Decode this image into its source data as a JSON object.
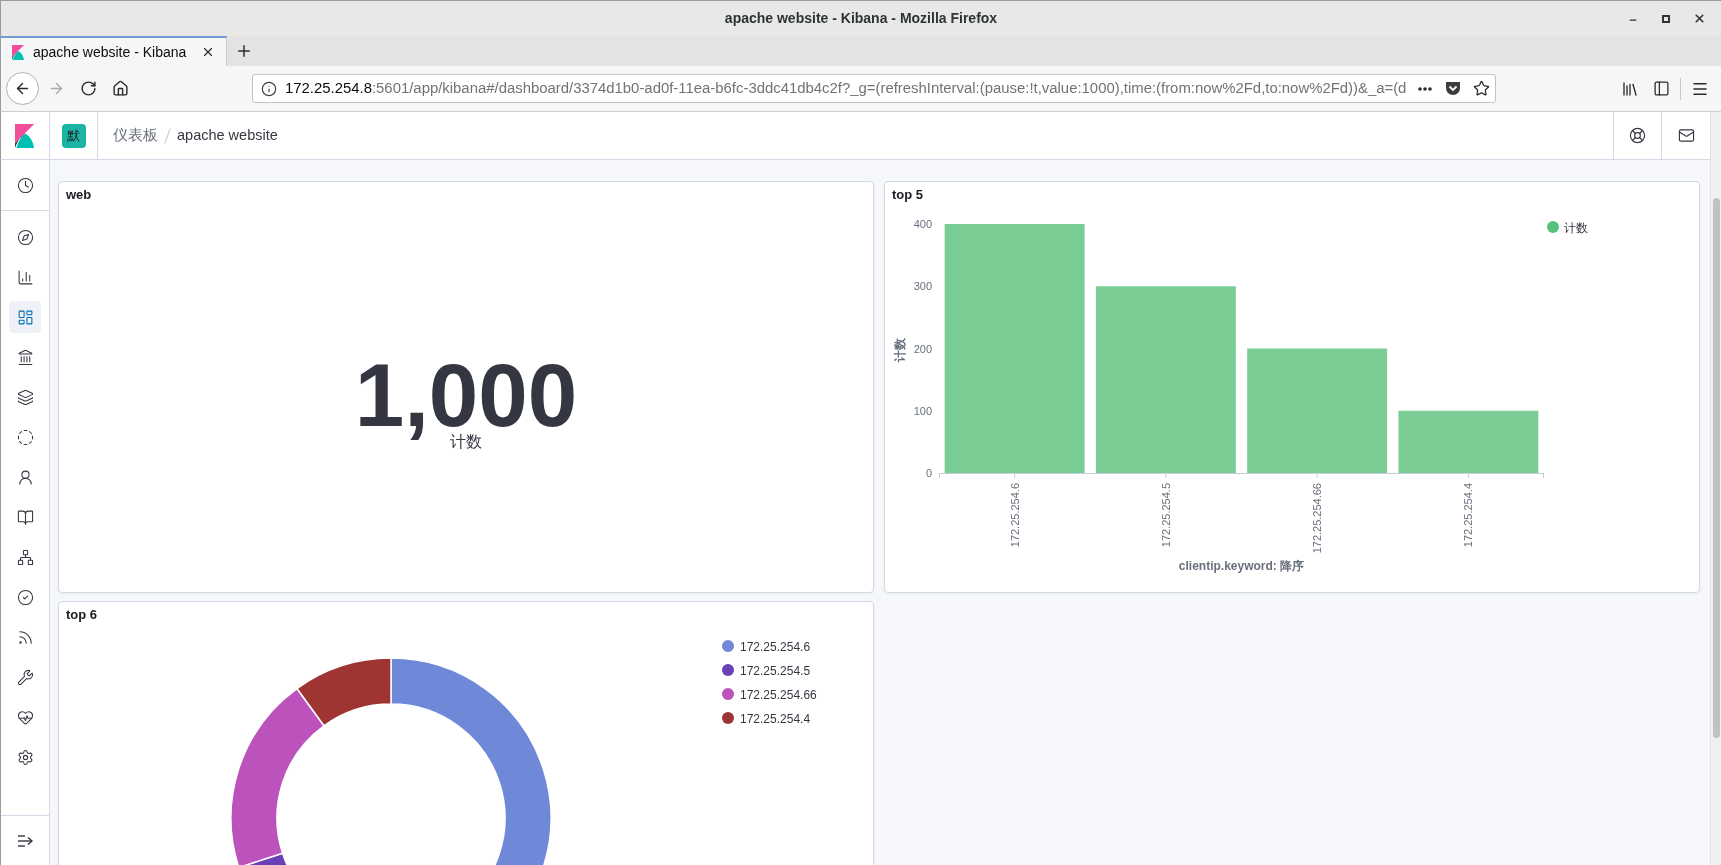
{
  "window": {
    "title": "apache website - Kibana - Mozilla Firefox"
  },
  "tabs": [
    {
      "label": "apache website - Kibana",
      "selected": true
    }
  ],
  "toolbar": {
    "buttons": [
      {
        "kind": "back",
        "disabled": false
      },
      {
        "kind": "forward",
        "disabled": true
      },
      {
        "kind": "reload",
        "disabled": false
      },
      {
        "kind": "home",
        "disabled": false
      }
    ]
  },
  "address_bar": {
    "host": "172.25.254.8",
    "path": ":5601/app/kibana#/dashboard/3374d1b0-ad0f-11ea-b6fc-3ddc41db4c2f?_g=(refreshInterval:(pause:!t,value:1000),time:(from:now%2Fd,to:now%2Fd))&_a=(d"
  },
  "kibana_header": {
    "space_avatar": "默",
    "breadcrumbs": [
      {
        "label": "仪表板"
      },
      {
        "label": "apache website"
      }
    ]
  },
  "side_nav": {
    "top": [
      {
        "kind": "clock",
        "selected": false
      }
    ],
    "items": [
      {
        "kind": "compass",
        "selected": false
      },
      {
        "kind": "bar_chart",
        "selected": false
      },
      {
        "kind": "dashboard",
        "selected": true
      },
      {
        "kind": "building",
        "selected": false
      },
      {
        "kind": "map_layers",
        "selected": false
      },
      {
        "kind": "dashed_circle",
        "selected": false
      },
      {
        "kind": "person",
        "selected": false
      },
      {
        "kind": "book",
        "selected": false
      },
      {
        "kind": "network",
        "selected": false
      },
      {
        "kind": "check_circle",
        "selected": false
      },
      {
        "kind": "signal",
        "selected": false
      },
      {
        "kind": "wrench",
        "selected": false
      },
      {
        "kind": "heart_pulse",
        "selected": false
      },
      {
        "kind": "gear",
        "selected": false
      }
    ]
  },
  "panels": [
    {
      "kind": "metric",
      "title": "web",
      "value": "1,000",
      "label": "计数"
    },
    {
      "kind": "chart",
      "title": "top 5",
      "chart_data": {
        "type": "bar",
        "xlabel": "clientip.keyword: 降序",
        "ylabel": "计数",
        "categories": [
          "172.25.254.6",
          "172.25.254.5",
          "172.25.254.66",
          "172.25.254.4"
        ],
        "series": [
          {
            "name": "计数",
            "color": "#57c17b",
            "values": [
              400,
              300,
              200,
              100
            ]
          }
        ],
        "ylim": [
          0,
          400
        ],
        "yticks": [
          0,
          100,
          200,
          300,
          400
        ]
      }
    },
    {
      "kind": "chart",
      "title": "top 6",
      "legend": [
        {
          "label": "172.25.254.6",
          "color": "#7088d8"
        },
        {
          "label": "172.25.254.5",
          "color": "#6a3fb8"
        },
        {
          "label": "172.25.254.66",
          "color": "#bc52bc"
        },
        {
          "label": "172.25.254.4",
          "color": "#9e3533"
        }
      ],
      "chart_data": {
        "type": "donut",
        "values": [
          40,
          30,
          20,
          10
        ]
      }
    }
  ]
}
